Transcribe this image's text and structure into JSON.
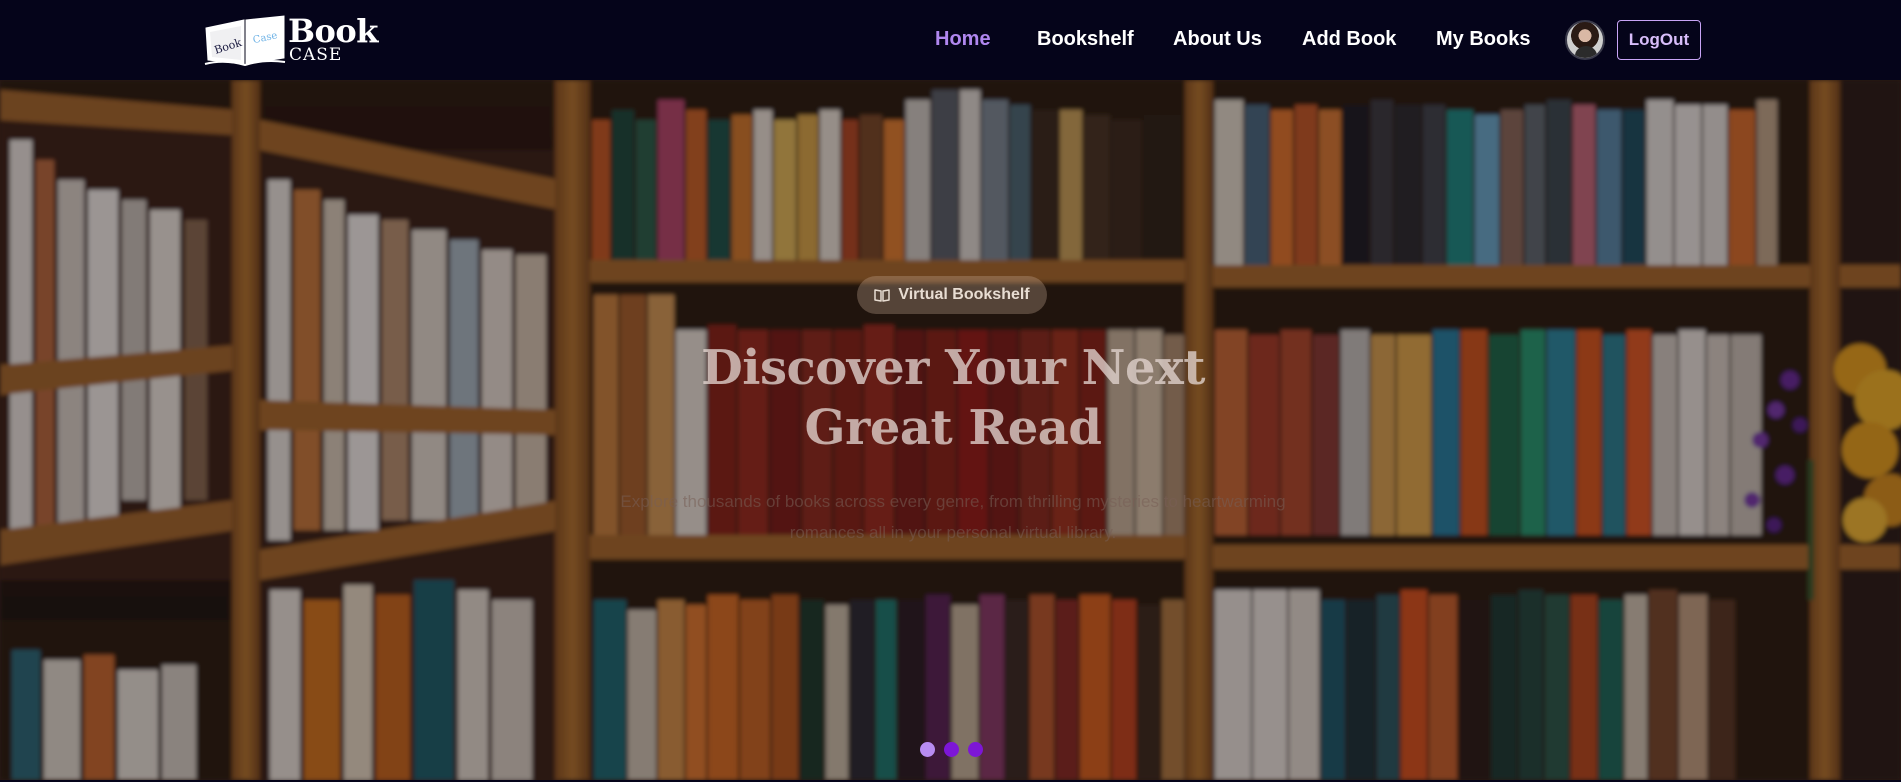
{
  "brand": {
    "name_line1": "Book",
    "name_line2": "CASE",
    "book_left": "Book",
    "book_right": "Case"
  },
  "nav": {
    "links": [
      {
        "label": "Home",
        "active": true
      },
      {
        "label": "Bookshelf",
        "active": false
      },
      {
        "label": "About Us",
        "active": false
      },
      {
        "label": "Add Book",
        "active": false
      },
      {
        "label": "My Books",
        "active": false
      }
    ],
    "logout_label": "LogOut"
  },
  "hero": {
    "badge_icon": "book-open-icon",
    "badge_label": "Virtual Bookshelf",
    "title": "Discover Your Next Great Read",
    "subtitle": "Explore thousands of books across every genre, from thrilling mysteries to heartwarming romances all in your personal virtual library.",
    "slides": [
      {
        "active": true
      },
      {
        "active": false
      },
      {
        "active": false
      }
    ]
  },
  "colors": {
    "nav_bg": "#05041a",
    "accent": "#b087ef",
    "dot": "#7d16d6",
    "dot_active": "#b88cf2"
  }
}
